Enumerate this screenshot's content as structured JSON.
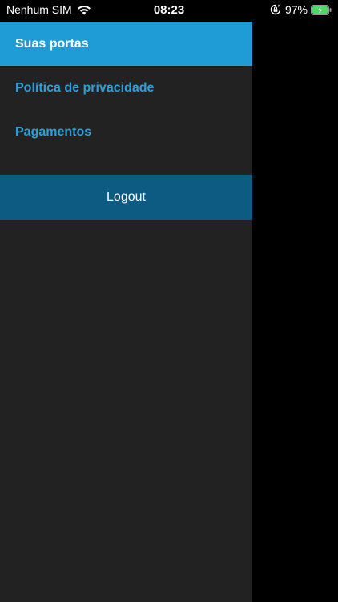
{
  "status_bar": {
    "carrier": "Nenhum SIM",
    "time": "08:23",
    "battery_percent": "97%",
    "icons": [
      "wifi-icon",
      "rotation-lock-icon",
      "battery-charging-icon"
    ],
    "battery_color": "#4cd964"
  },
  "drawer": {
    "items": [
      {
        "label": "Suas portas",
        "active": true
      },
      {
        "label": "Política de privacidade",
        "active": false
      },
      {
        "label": "Pagamentos",
        "active": false
      }
    ],
    "logout_label": "Logout",
    "colors": {
      "background": "#222222",
      "active_bg": "#1f9cd6",
      "link_text": "#2d9fd8",
      "logout_bg": "#0d5b82"
    }
  }
}
